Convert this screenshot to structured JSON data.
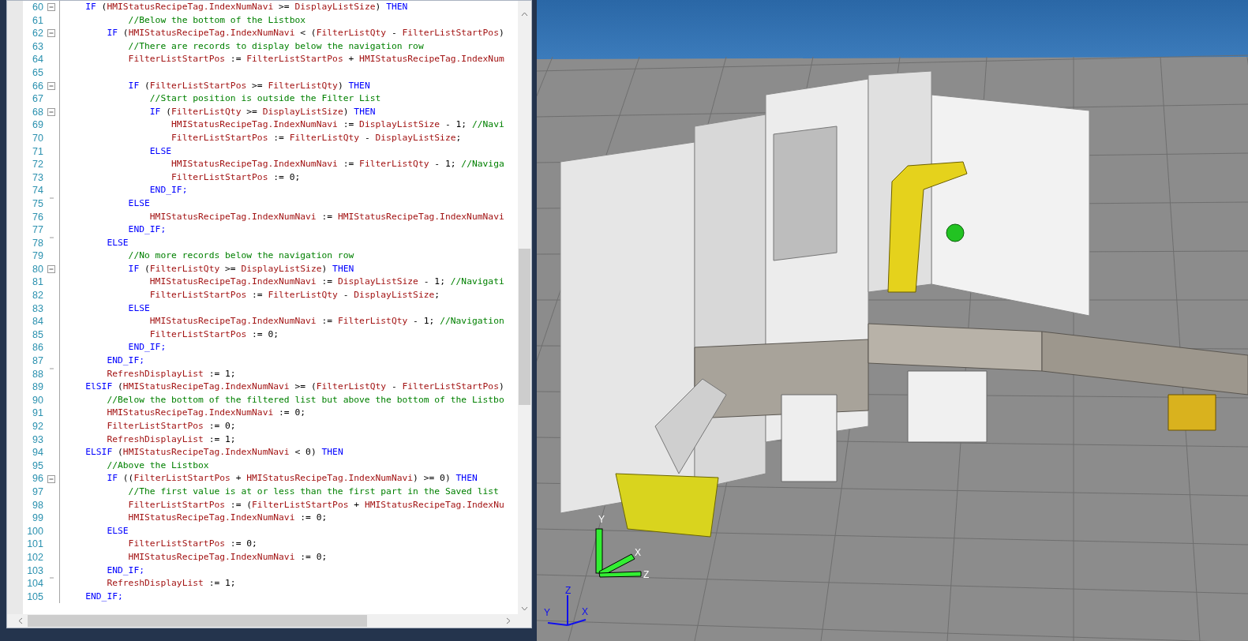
{
  "editor": {
    "lines": [
      {
        "number": "60",
        "fold_start": true,
        "tokens": [
          {
            "kind": "keyword",
            "text": "    IF"
          },
          {
            "kind": "op",
            "text": " ("
          },
          {
            "kind": "name",
            "text": "HMIStatusRecipeTag.IndexNumNavi"
          },
          {
            "kind": "op",
            "text": " >= "
          },
          {
            "kind": "name",
            "text": "DisplayListSize"
          },
          {
            "kind": "op",
            "text": ") "
          },
          {
            "kind": "keyword",
            "text": "THEN"
          }
        ]
      },
      {
        "number": "61",
        "tokens": [
          {
            "kind": "comment",
            "text": "            //Below the bottom of the Listbox"
          }
        ]
      },
      {
        "number": "62",
        "fold_start": true,
        "tokens": [
          {
            "kind": "keyword",
            "text": "        IF"
          },
          {
            "kind": "op",
            "text": " ("
          },
          {
            "kind": "name",
            "text": "HMIStatusRecipeTag.IndexNumNavi"
          },
          {
            "kind": "op",
            "text": " < ("
          },
          {
            "kind": "name",
            "text": "FilterListQty"
          },
          {
            "kind": "op",
            "text": " - "
          },
          {
            "kind": "name",
            "text": "FilterListStartPos"
          },
          {
            "kind": "op",
            "text": ")"
          }
        ]
      },
      {
        "number": "63",
        "tokens": [
          {
            "kind": "comment",
            "text": "            //There are records to display below the navigation row"
          }
        ]
      },
      {
        "number": "64",
        "tokens": [
          {
            "kind": "name",
            "text": "            FilterListStartPos"
          },
          {
            "kind": "op",
            "text": " := "
          },
          {
            "kind": "name",
            "text": "FilterListStartPos"
          },
          {
            "kind": "op",
            "text": " + "
          },
          {
            "kind": "name",
            "text": "HMIStatusRecipeTag.IndexNum"
          }
        ]
      },
      {
        "number": "65"
      },
      {
        "number": "66",
        "fold_start": true,
        "tokens": [
          {
            "kind": "keyword",
            "text": "            IF"
          },
          {
            "kind": "op",
            "text": " ("
          },
          {
            "kind": "name",
            "text": "FilterListStartPos"
          },
          {
            "kind": "op",
            "text": " >= "
          },
          {
            "kind": "name",
            "text": "FilterListQty"
          },
          {
            "kind": "op",
            "text": ") "
          },
          {
            "kind": "keyword",
            "text": "THEN"
          }
        ]
      },
      {
        "number": "67",
        "tokens": [
          {
            "kind": "comment",
            "text": "                //Start position is outside the Filter List"
          }
        ]
      },
      {
        "number": "68",
        "fold_start": true,
        "tokens": [
          {
            "kind": "keyword",
            "text": "                IF"
          },
          {
            "kind": "op",
            "text": " ("
          },
          {
            "kind": "name",
            "text": "FilterListQty"
          },
          {
            "kind": "op",
            "text": " >= "
          },
          {
            "kind": "name",
            "text": "DisplayListSize"
          },
          {
            "kind": "op",
            "text": ") "
          },
          {
            "kind": "keyword",
            "text": "THEN"
          }
        ]
      },
      {
        "number": "69",
        "tokens": [
          {
            "kind": "name",
            "text": "                    HMIStatusRecipeTag.IndexNumNavi"
          },
          {
            "kind": "op",
            "text": " := "
          },
          {
            "kind": "name",
            "text": "DisplayListSize"
          },
          {
            "kind": "op",
            "text": " - 1; "
          },
          {
            "kind": "comment",
            "text": "//Navi"
          }
        ]
      },
      {
        "number": "70",
        "tokens": [
          {
            "kind": "name",
            "text": "                    FilterListStartPos"
          },
          {
            "kind": "op",
            "text": " := "
          },
          {
            "kind": "name",
            "text": "FilterListQty"
          },
          {
            "kind": "op",
            "text": " - "
          },
          {
            "kind": "name",
            "text": "DisplayListSize"
          },
          {
            "kind": "op",
            "text": ";"
          }
        ]
      },
      {
        "number": "71",
        "tokens": [
          {
            "kind": "keyword",
            "text": "                ELSE"
          }
        ]
      },
      {
        "number": "72",
        "tokens": [
          {
            "kind": "name",
            "text": "                    HMIStatusRecipeTag.IndexNumNavi"
          },
          {
            "kind": "op",
            "text": " := "
          },
          {
            "kind": "name",
            "text": "FilterListQty"
          },
          {
            "kind": "op",
            "text": " - 1; "
          },
          {
            "kind": "comment",
            "text": "//Naviga"
          }
        ]
      },
      {
        "number": "73",
        "tokens": [
          {
            "kind": "name",
            "text": "                    FilterListStartPos"
          },
          {
            "kind": "op",
            "text": " := 0;"
          }
        ]
      },
      {
        "number": "74",
        "tokens": [
          {
            "kind": "keyword",
            "text": "                END_IF;"
          }
        ]
      },
      {
        "number": "75",
        "fold_end": true,
        "tokens": [
          {
            "kind": "keyword",
            "text": "            ELSE"
          }
        ]
      },
      {
        "number": "76",
        "tokens": [
          {
            "kind": "name",
            "text": "                HMIStatusRecipeTag.IndexNumNavi"
          },
          {
            "kind": "op",
            "text": " := "
          },
          {
            "kind": "name",
            "text": "HMIStatusRecipeTag.IndexNumNavi"
          }
        ]
      },
      {
        "number": "77",
        "tokens": [
          {
            "kind": "keyword",
            "text": "            END_IF;"
          }
        ]
      },
      {
        "number": "78",
        "fold_end": true,
        "tokens": [
          {
            "kind": "keyword",
            "text": "        ELSE"
          }
        ]
      },
      {
        "number": "79",
        "tokens": [
          {
            "kind": "comment",
            "text": "            //No more records below the navigation row"
          }
        ]
      },
      {
        "number": "80",
        "fold_start": true,
        "tokens": [
          {
            "kind": "keyword",
            "text": "            IF"
          },
          {
            "kind": "op",
            "text": " ("
          },
          {
            "kind": "name",
            "text": "FilterListQty"
          },
          {
            "kind": "op",
            "text": " >= "
          },
          {
            "kind": "name",
            "text": "DisplayListSize"
          },
          {
            "kind": "op",
            "text": ") "
          },
          {
            "kind": "keyword",
            "text": "THEN"
          }
        ]
      },
      {
        "number": "81",
        "tokens": [
          {
            "kind": "name",
            "text": "                HMIStatusRecipeTag.IndexNumNavi"
          },
          {
            "kind": "op",
            "text": " := "
          },
          {
            "kind": "name",
            "text": "DisplayListSize"
          },
          {
            "kind": "op",
            "text": " - 1; "
          },
          {
            "kind": "comment",
            "text": "//Navigati"
          }
        ]
      },
      {
        "number": "82",
        "tokens": [
          {
            "kind": "name",
            "text": "                FilterListStartPos"
          },
          {
            "kind": "op",
            "text": " := "
          },
          {
            "kind": "name",
            "text": "FilterListQty"
          },
          {
            "kind": "op",
            "text": " - "
          },
          {
            "kind": "name",
            "text": "DisplayListSize"
          },
          {
            "kind": "op",
            "text": ";"
          }
        ]
      },
      {
        "number": "83",
        "tokens": [
          {
            "kind": "keyword",
            "text": "            ELSE"
          }
        ]
      },
      {
        "number": "84",
        "tokens": [
          {
            "kind": "name",
            "text": "                HMIStatusRecipeTag.IndexNumNavi"
          },
          {
            "kind": "op",
            "text": " := "
          },
          {
            "kind": "name",
            "text": "FilterListQty"
          },
          {
            "kind": "op",
            "text": " - 1; "
          },
          {
            "kind": "comment",
            "text": "//Navigation"
          }
        ]
      },
      {
        "number": "85",
        "tokens": [
          {
            "kind": "name",
            "text": "                FilterListStartPos"
          },
          {
            "kind": "op",
            "text": " := 0;"
          }
        ]
      },
      {
        "number": "86",
        "tokens": [
          {
            "kind": "keyword",
            "text": "            END_IF;"
          }
        ]
      },
      {
        "number": "87",
        "tokens": [
          {
            "kind": "keyword",
            "text": "        END_IF;"
          }
        ]
      },
      {
        "number": "88",
        "fold_end": true,
        "tokens": [
          {
            "kind": "name",
            "text": "        RefreshDisplayList"
          },
          {
            "kind": "op",
            "text": " := 1;"
          }
        ]
      },
      {
        "number": "89",
        "tokens": [
          {
            "kind": "keyword",
            "text": "    ElSIF"
          },
          {
            "kind": "op",
            "text": " ("
          },
          {
            "kind": "name",
            "text": "HMIStatusRecipeTag.IndexNumNavi"
          },
          {
            "kind": "op",
            "text": " >= ("
          },
          {
            "kind": "name",
            "text": "FilterListQty"
          },
          {
            "kind": "op",
            "text": " - "
          },
          {
            "kind": "name",
            "text": "FilterListStartPos"
          },
          {
            "kind": "op",
            "text": ")"
          }
        ]
      },
      {
        "number": "90",
        "tokens": [
          {
            "kind": "comment",
            "text": "        //Below the bottom of the filtered list but above the bottom of the Listbo"
          }
        ]
      },
      {
        "number": "91",
        "tokens": [
          {
            "kind": "name",
            "text": "        HMIStatusRecipeTag.IndexNumNavi"
          },
          {
            "kind": "op",
            "text": " := 0;"
          }
        ]
      },
      {
        "number": "92",
        "tokens": [
          {
            "kind": "name",
            "text": "        FilterListStartPos"
          },
          {
            "kind": "op",
            "text": " := 0;"
          }
        ]
      },
      {
        "number": "93",
        "tokens": [
          {
            "kind": "name",
            "text": "        RefreshDisplayList"
          },
          {
            "kind": "op",
            "text": " := 1;"
          }
        ]
      },
      {
        "number": "94",
        "tokens": [
          {
            "kind": "keyword",
            "text": "    ELSIF"
          },
          {
            "kind": "op",
            "text": " ("
          },
          {
            "kind": "name",
            "text": "HMIStatusRecipeTag.IndexNumNavi"
          },
          {
            "kind": "op",
            "text": " < 0) "
          },
          {
            "kind": "keyword",
            "text": "THEN"
          }
        ]
      },
      {
        "number": "95",
        "tokens": [
          {
            "kind": "comment",
            "text": "        //Above the Listbox"
          }
        ]
      },
      {
        "number": "96",
        "fold_start": true,
        "tokens": [
          {
            "kind": "keyword",
            "text": "        IF"
          },
          {
            "kind": "op",
            "text": " (("
          },
          {
            "kind": "name",
            "text": "FilterListStartPos"
          },
          {
            "kind": "op",
            "text": " + "
          },
          {
            "kind": "name",
            "text": "HMIStatusRecipeTag.IndexNumNavi"
          },
          {
            "kind": "op",
            "text": ") >= 0) "
          },
          {
            "kind": "keyword",
            "text": "THEN"
          }
        ]
      },
      {
        "number": "97",
        "tokens": [
          {
            "kind": "comment",
            "text": "            //The first value is at or less than the first part in the Saved list"
          }
        ]
      },
      {
        "number": "98",
        "tokens": [
          {
            "kind": "name",
            "text": "            FilterListStartPos"
          },
          {
            "kind": "op",
            "text": " := ("
          },
          {
            "kind": "name",
            "text": "FilterListStartPos"
          },
          {
            "kind": "op",
            "text": " + "
          },
          {
            "kind": "name",
            "text": "HMIStatusRecipeTag.IndexNu"
          }
        ]
      },
      {
        "number": "99",
        "tokens": [
          {
            "kind": "name",
            "text": "            HMIStatusRecipeTag.IndexNumNavi"
          },
          {
            "kind": "op",
            "text": " := 0;"
          }
        ]
      },
      {
        "number": "100",
        "tokens": [
          {
            "kind": "keyword",
            "text": "        ELSE"
          }
        ]
      },
      {
        "number": "101",
        "tokens": [
          {
            "kind": "name",
            "text": "            FilterListStartPos"
          },
          {
            "kind": "op",
            "text": " := 0;"
          }
        ]
      },
      {
        "number": "102",
        "tokens": [
          {
            "kind": "name",
            "text": "            HMIStatusRecipeTag.IndexNumNavi"
          },
          {
            "kind": "op",
            "text": " := 0;"
          }
        ]
      },
      {
        "number": "103",
        "tokens": [
          {
            "kind": "keyword",
            "text": "        END_IF;"
          }
        ]
      },
      {
        "number": "104",
        "fold_end": true,
        "tokens": [
          {
            "kind": "name",
            "text": "        RefreshDisplayList"
          },
          {
            "kind": "op",
            "text": " := 1;"
          }
        ]
      },
      {
        "number": "105",
        "tokens": [
          {
            "kind": "keyword",
            "text": "    END_IF;"
          }
        ]
      }
    ]
  },
  "viewport": {
    "gizmo_labels": [
      "Y",
      "X",
      "Z"
    ],
    "triad_labels": [
      "Z",
      "Y",
      "X"
    ]
  }
}
